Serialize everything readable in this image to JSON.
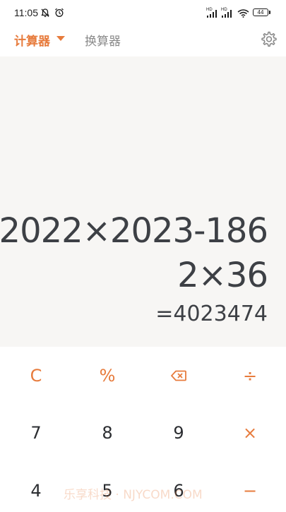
{
  "status_bar": {
    "time": "11:05",
    "signal1_label": "HD",
    "signal2_label": "HD",
    "battery": "44"
  },
  "header": {
    "tab_active": "计算器",
    "tab_inactive": "换算器"
  },
  "display": {
    "expression_line1": "2022×2023-186",
    "expression_line2": "2×36",
    "result": "=4023474"
  },
  "keypad": {
    "row1": [
      "C",
      "%",
      "⌫",
      "÷"
    ],
    "row2": [
      "7",
      "8",
      "9",
      "×"
    ],
    "row3": [
      "4",
      "5",
      "6",
      "−"
    ]
  },
  "watermark": "乐享科技 · NJYCOM.COM",
  "colors": {
    "accent": "#e77b3c",
    "display_bg": "#f7f6f4",
    "text": "#3d4045"
  }
}
